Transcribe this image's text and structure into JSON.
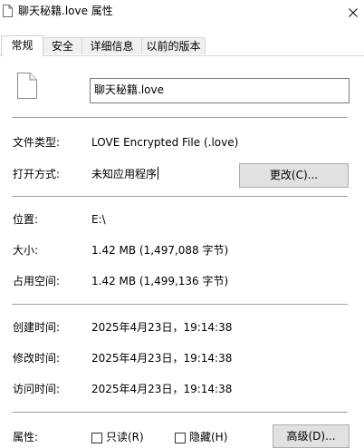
{
  "window": {
    "title": "聊天秘籍.love 属性",
    "close_glyph": "✕"
  },
  "tabs": [
    {
      "label": "常规",
      "active": true
    },
    {
      "label": "安全",
      "active": false
    },
    {
      "label": "详细信息",
      "active": false
    },
    {
      "label": "以前的版本",
      "active": false
    }
  ],
  "general": {
    "file_name": "聊天秘籍.love",
    "file_icon": "blank-document-icon",
    "type_label": "文件类型:",
    "type_value": "LOVE Encrypted File (.love)",
    "open_with_label": "打开方式:",
    "open_with_value": "未知应用程序",
    "change_button": "更改(C)...",
    "location_label": "位置:",
    "location_value": "E:\\",
    "size_label": "大小:",
    "size_value": "1.42 MB (1,497,088 字节)",
    "size_on_disk_label": "占用空间:",
    "size_on_disk_value": "1.42 MB (1,499,136 字节)",
    "created_label": "创建时间:",
    "created_value": "2025年4月23日，19:14:38",
    "modified_label": "修改时间:",
    "modified_value": "2025年4月23日，19:14:38",
    "accessed_label": "访问时间:",
    "accessed_value": "2025年4月23日，19:14:38",
    "attributes_label": "属性:",
    "readonly_label": "只读(R)",
    "readonly_checked": false,
    "hidden_label": "隐藏(H)",
    "hidden_checked": false,
    "advanced_button": "高级(D)..."
  }
}
